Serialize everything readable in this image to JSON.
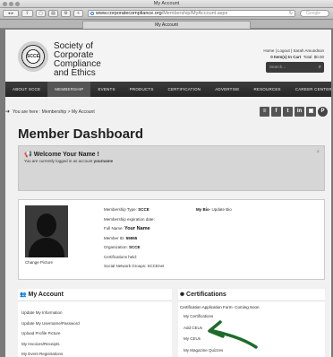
{
  "window": {
    "title": "My Account",
    "tab_title": "My Account",
    "url_host": "www.corporatecompliance.org",
    "url_path": "/Membership/MyAccount.aspx",
    "search_placeholder": "Google"
  },
  "header": {
    "logo_text": "SCCE",
    "org_name_lines": [
      "Society of",
      "Corporate",
      "Compliance",
      "and Ethics"
    ],
    "links": "Home | Logout | Sarah Amundson",
    "cart_items": "0 Item(s) In Cart",
    "cart_total": "Total: $0.00",
    "search_placeholder": "Search..."
  },
  "nav": {
    "items": [
      "ABOUT SCCE",
      "MEMBERSHIP",
      "EVENTS",
      "PRODUCTS",
      "CERTIFICATION",
      "ADVERTISE",
      "RESOURCES",
      "CAREER CENTER"
    ],
    "active_index": 1
  },
  "breadcrumb": {
    "prefix": "You are here :",
    "items": [
      "Membership",
      "My Account"
    ],
    "separator": ">"
  },
  "social": [
    "≡",
    "f",
    "t",
    "in",
    "▣",
    "P"
  ],
  "page_title": "Member Dashboard",
  "welcome": {
    "title": "Welcome  Your Name !",
    "subtitle_prefix": "You are currently logged in as account",
    "username": "yourname",
    "close": "×"
  },
  "profile": {
    "change_picture": "Change Picture",
    "fields": [
      {
        "label": "Membership Type:",
        "value": "SCCE"
      },
      {
        "label": "Membership expiration date:",
        "value": ""
      },
      {
        "label": "Full Name:",
        "value": "Your Name"
      },
      {
        "label": "Member ID:",
        "value": "55555"
      },
      {
        "label": "Organization:",
        "value": "SCCE"
      },
      {
        "label": "Certifications held:",
        "value": ""
      },
      {
        "label": "Social Network Groups:",
        "value": "SCCEnet"
      }
    ],
    "bio_label": "My Bio",
    "bio_link": "- Update Bio"
  },
  "my_account": {
    "title": "My Account",
    "links": [
      "Update My Information",
      "Update My Username/Password",
      "Upload Profile Picture",
      "My Invoices/Receipts",
      "My Event Registrations"
    ]
  },
  "certifications": {
    "title": "Certifications",
    "form_text": "Certification Application Form- Coming Soon",
    "links": [
      "My Certifications",
      "Add CEUs",
      "My CEUs",
      "My Magazine Quizzes"
    ]
  },
  "colors": {
    "nav_bg": "#2f2f2f",
    "annotation": "#1f6b2c"
  }
}
